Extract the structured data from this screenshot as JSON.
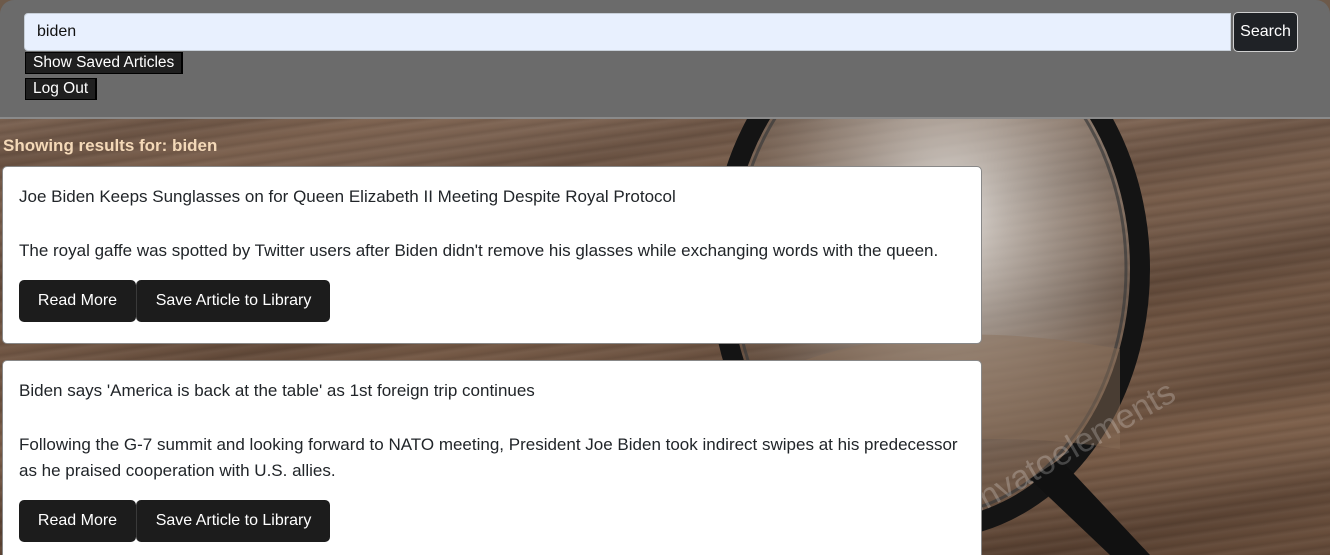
{
  "search": {
    "value": "biden",
    "button_label": "Search"
  },
  "nav": {
    "show_saved_label": "Show Saved Articles",
    "logout_label": "Log Out"
  },
  "results": {
    "heading": "Showing results for: biden",
    "articles": [
      {
        "title": "Joe Biden Keeps Sunglasses on for Queen Elizabeth II Meeting Despite Royal Protocol",
        "description": "The royal gaffe was spotted by Twitter users after Biden didn't remove his glasses while exchanging words with the queen.",
        "read_more_label": "Read More",
        "save_label": "Save Article to Library"
      },
      {
        "title": "Biden says 'America is back at the table' as 1st foreign trip continues",
        "description": "Following the G-7 summit and looking forward to NATO meeting, President Joe Biden took indirect swipes at his predecessor as he praised cooperation with U.S. allies.",
        "read_more_label": "Read More",
        "save_label": "Save Article to Library"
      }
    ]
  },
  "background": {
    "watermark": "envatoelements",
    "illustration": "magnifying-glass-on-wooden-table"
  },
  "colors": {
    "header_bg": "#6b6b6b",
    "search_input_bg": "#e8f0fe",
    "button_dark": "#1c1c1c",
    "results_heading": "#f4d9b8",
    "card_bg": "#ffffff"
  }
}
